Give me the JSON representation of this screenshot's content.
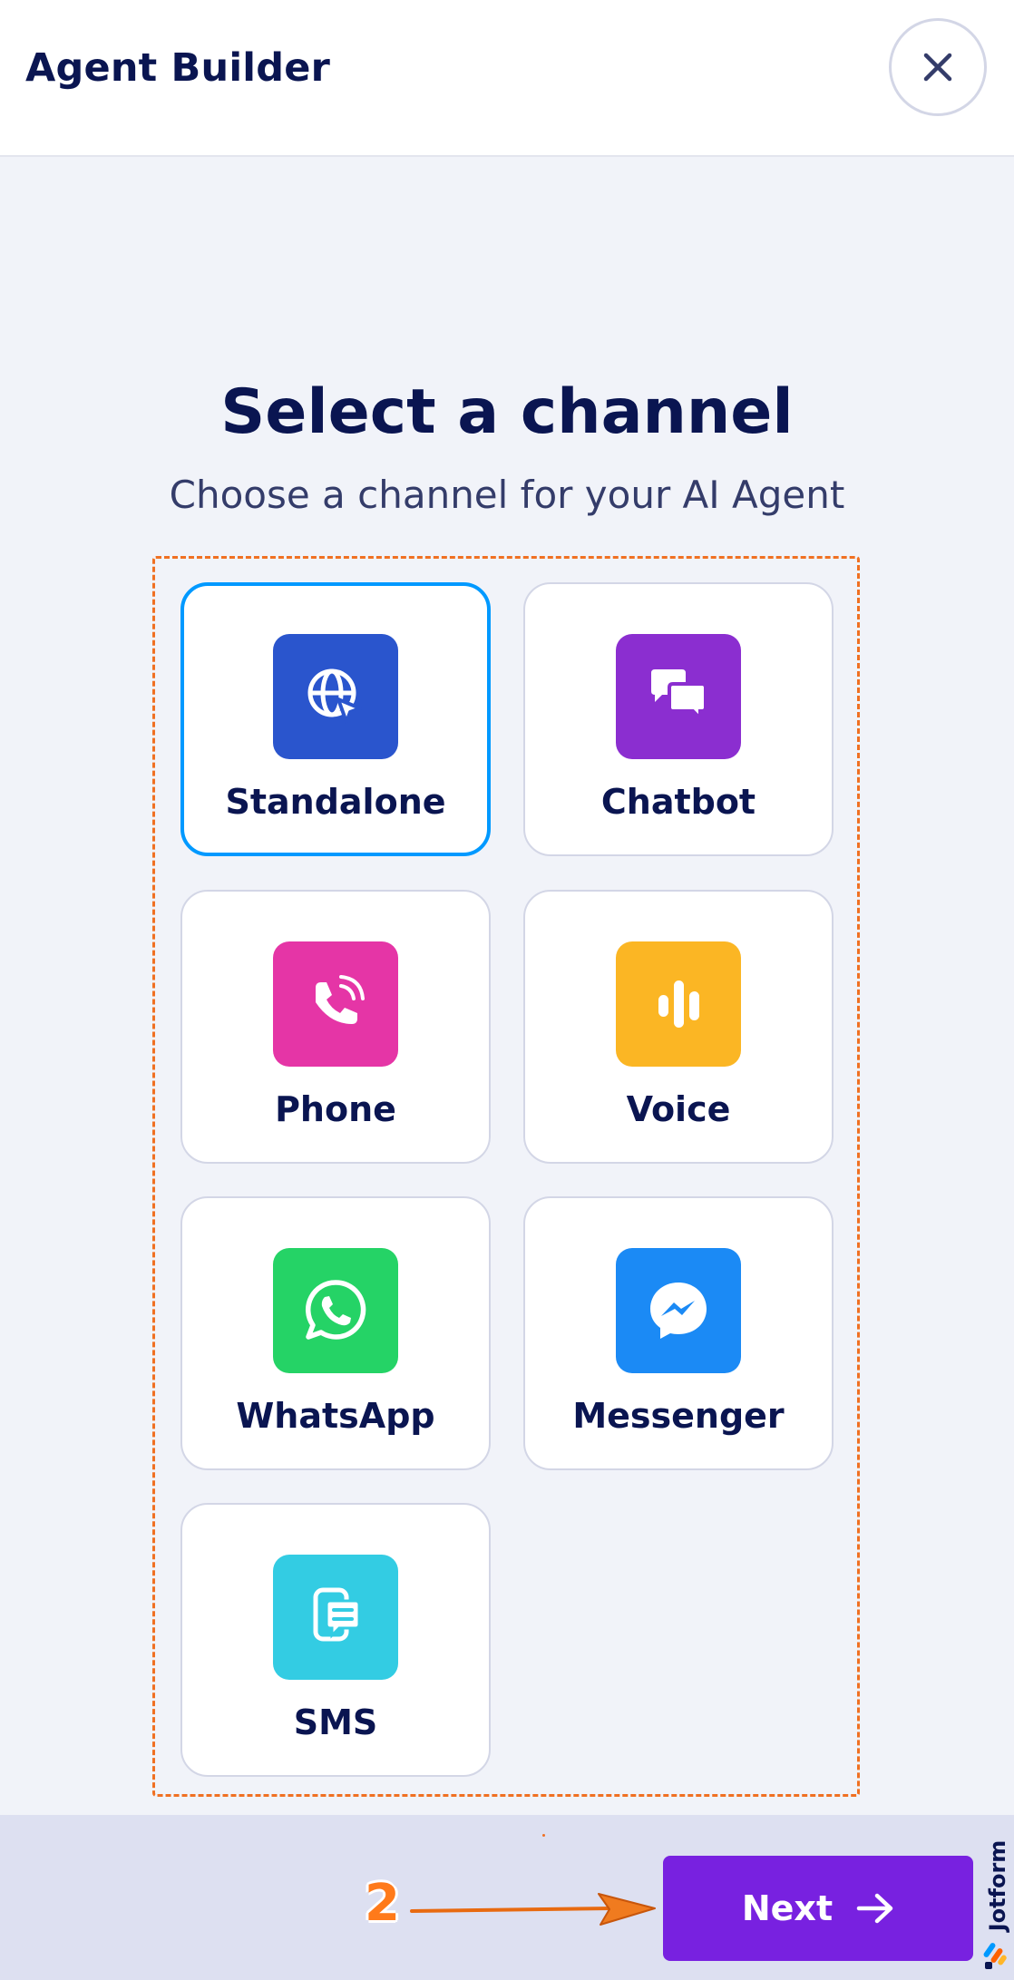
{
  "header": {
    "title": "Agent Builder",
    "close_icon": "close-icon"
  },
  "main": {
    "heading": "Select a channel",
    "subheading": "Choose a channel for your AI Agent",
    "channels": [
      {
        "label": "Standalone",
        "icon": "globe-cursor-icon",
        "color": "#2a55cd",
        "selected": true
      },
      {
        "label": "Chatbot",
        "icon": "chat-bubbles-icon",
        "color": "#8b2ed0",
        "selected": false
      },
      {
        "label": "Phone",
        "icon": "phone-icon",
        "color": "#e535a6",
        "selected": false
      },
      {
        "label": "Voice",
        "icon": "audio-bars-icon",
        "color": "#fbb624",
        "selected": false
      },
      {
        "label": "WhatsApp",
        "icon": "whatsapp-icon",
        "color": "#25d366",
        "selected": false
      },
      {
        "label": "Messenger",
        "icon": "messenger-icon",
        "color": "#1b8af5",
        "selected": false
      },
      {
        "label": "SMS",
        "icon": "sms-icon",
        "color": "#33cce3",
        "selected": false
      }
    ]
  },
  "footer": {
    "next_label": "Next",
    "step_number": "2",
    "brand": "Jotform",
    "accent": "#7821e0"
  }
}
